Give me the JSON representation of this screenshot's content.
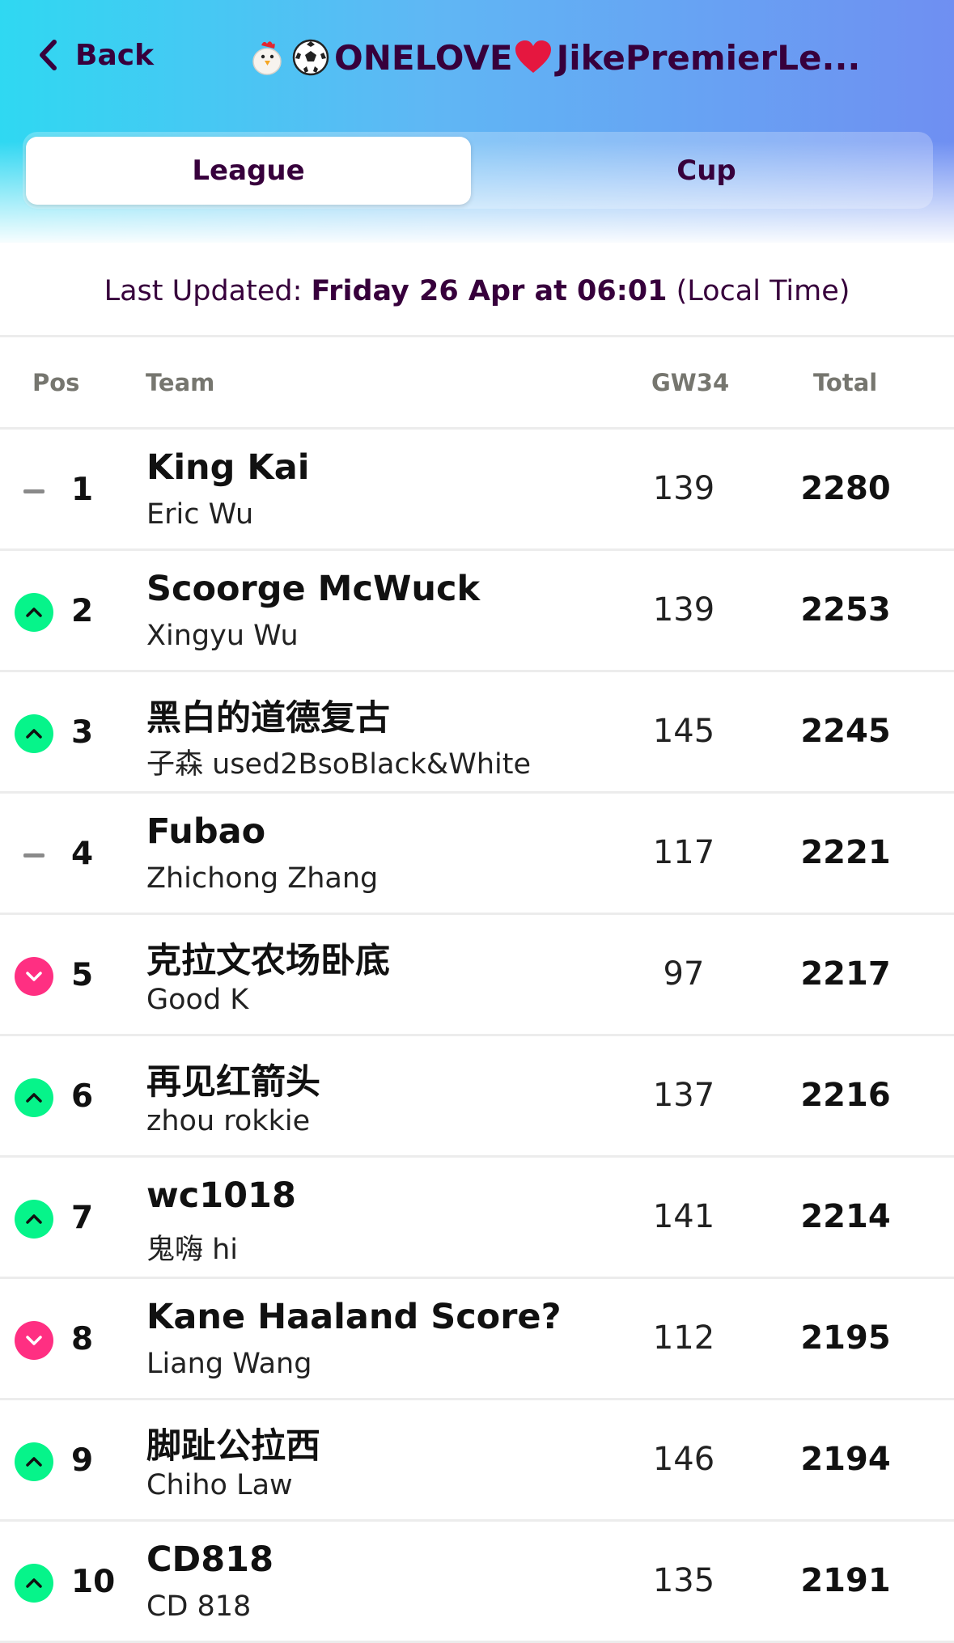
{
  "nav": {
    "back_label": "Back",
    "title": "ONELOVE JikePremierLe..."
  },
  "tabs": [
    {
      "label": "League",
      "active": true
    },
    {
      "label": "Cup",
      "active": false
    }
  ],
  "updated": {
    "prefix": "Last Updated: ",
    "date": "Friday 26 Apr at 06:01",
    "suffix": " (Local Time)"
  },
  "table": {
    "headers": {
      "pos": "Pos",
      "team": "Team",
      "gw": "GW34",
      "total": "Total"
    },
    "rows": [
      {
        "movement": "same",
        "pos": "1",
        "team": "King Kai",
        "manager": "Eric Wu",
        "gw": "139",
        "total": "2280"
      },
      {
        "movement": "up",
        "pos": "2",
        "team": "Scoorge McWuck",
        "manager": "Xingyu Wu",
        "gw": "139",
        "total": "2253"
      },
      {
        "movement": "up",
        "pos": "3",
        "team": "黑白的道德复古",
        "manager": "子森 used2BsoBlack&White",
        "gw": "145",
        "total": "2245"
      },
      {
        "movement": "same",
        "pos": "4",
        "team": "Fubao",
        "manager": "Zhichong Zhang",
        "gw": "117",
        "total": "2221"
      },
      {
        "movement": "down",
        "pos": "5",
        "team": "克拉文农场卧底",
        "manager": "Good K",
        "gw": "97",
        "total": "2217"
      },
      {
        "movement": "up",
        "pos": "6",
        "team": "再见红箭头",
        "manager": "zhou rokkie",
        "gw": "137",
        "total": "2216"
      },
      {
        "movement": "up",
        "pos": "7",
        "team": "wc1018",
        "manager": "鬼嗨 hi",
        "gw": "141",
        "total": "2214"
      },
      {
        "movement": "down",
        "pos": "8",
        "team": "Kane Haaland Score?",
        "manager": "Liang Wang",
        "gw": "112",
        "total": "2195"
      },
      {
        "movement": "up",
        "pos": "9",
        "team": "脚趾公拉西",
        "manager": "Chiho Law",
        "gw": "146",
        "total": "2194"
      },
      {
        "movement": "up",
        "pos": "10",
        "team": "CD818",
        "manager": "CD 818",
        "gw": "135",
        "total": "2191"
      }
    ]
  },
  "colors": {
    "brand": "#37003c",
    "up": "#06f48a",
    "down": "#ff2f82"
  }
}
